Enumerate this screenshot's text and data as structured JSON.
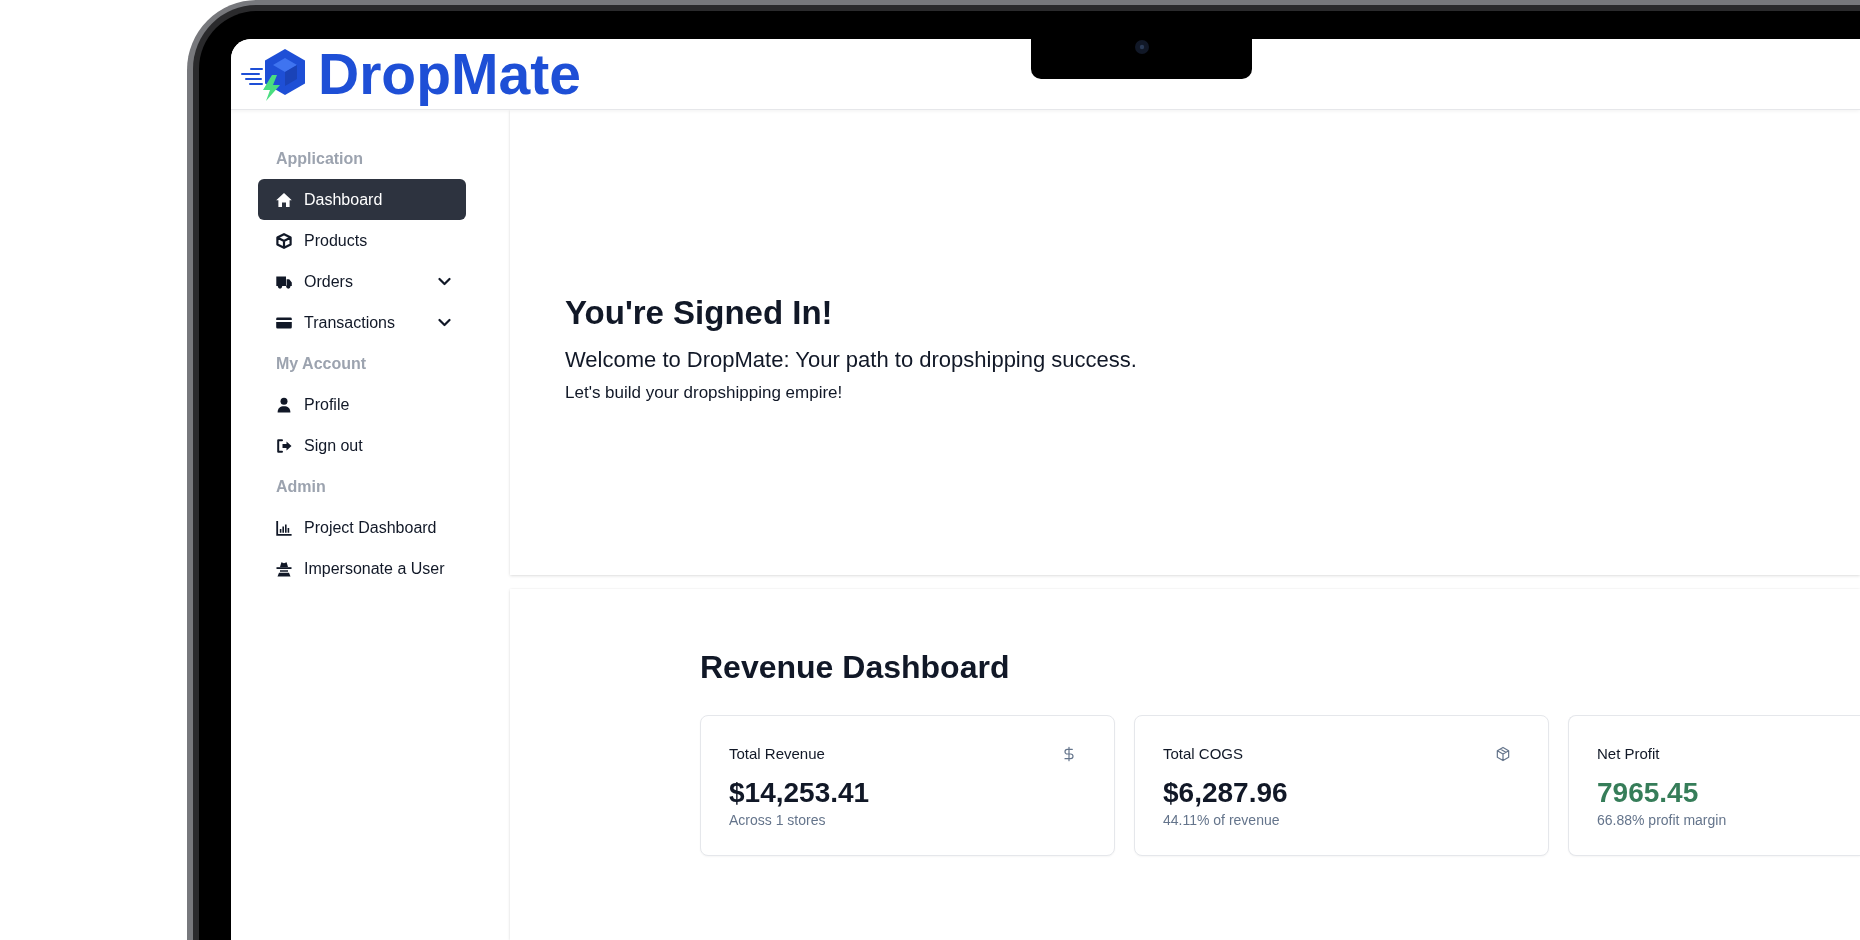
{
  "logo": {
    "text": "DropMate"
  },
  "sidebar": {
    "sections": [
      {
        "title": "Application",
        "items": [
          {
            "label": "Dashboard",
            "selected": true
          },
          {
            "label": "Products",
            "selected": false
          },
          {
            "label": "Orders",
            "selected": false,
            "expanded": false
          },
          {
            "label": "Transactions",
            "selected": false,
            "expanded": false
          }
        ]
      },
      {
        "title": "My Account",
        "items": [
          {
            "label": "Profile",
            "selected": false
          },
          {
            "label": "Sign out",
            "selected": false
          }
        ]
      },
      {
        "title": "Admin",
        "items": [
          {
            "label": "Project Dashboard",
            "selected": false
          },
          {
            "label": "Impersonate a User",
            "selected": false
          }
        ]
      }
    ]
  },
  "hero": {
    "title": "You're Signed In!",
    "subtitle": "Welcome to DropMate: Your path to dropshipping success.",
    "text": "Let's build your dropshipping empire!"
  },
  "revenue": {
    "title": "Revenue Dashboard",
    "cards": [
      {
        "kind": "revenue",
        "title": "Total Revenue",
        "value": "$14,253.41",
        "note": "Across 1 stores",
        "color": "#111827"
      },
      {
        "kind": "cogs",
        "title": "Total COGS",
        "value": "$6,287.96",
        "note": "44.11% of revenue",
        "color": "#111827"
      },
      {
        "kind": "profit",
        "title": "Net Profit",
        "value": "7965.45",
        "note": "66.88% profit margin",
        "color": "#367d59"
      }
    ]
  }
}
